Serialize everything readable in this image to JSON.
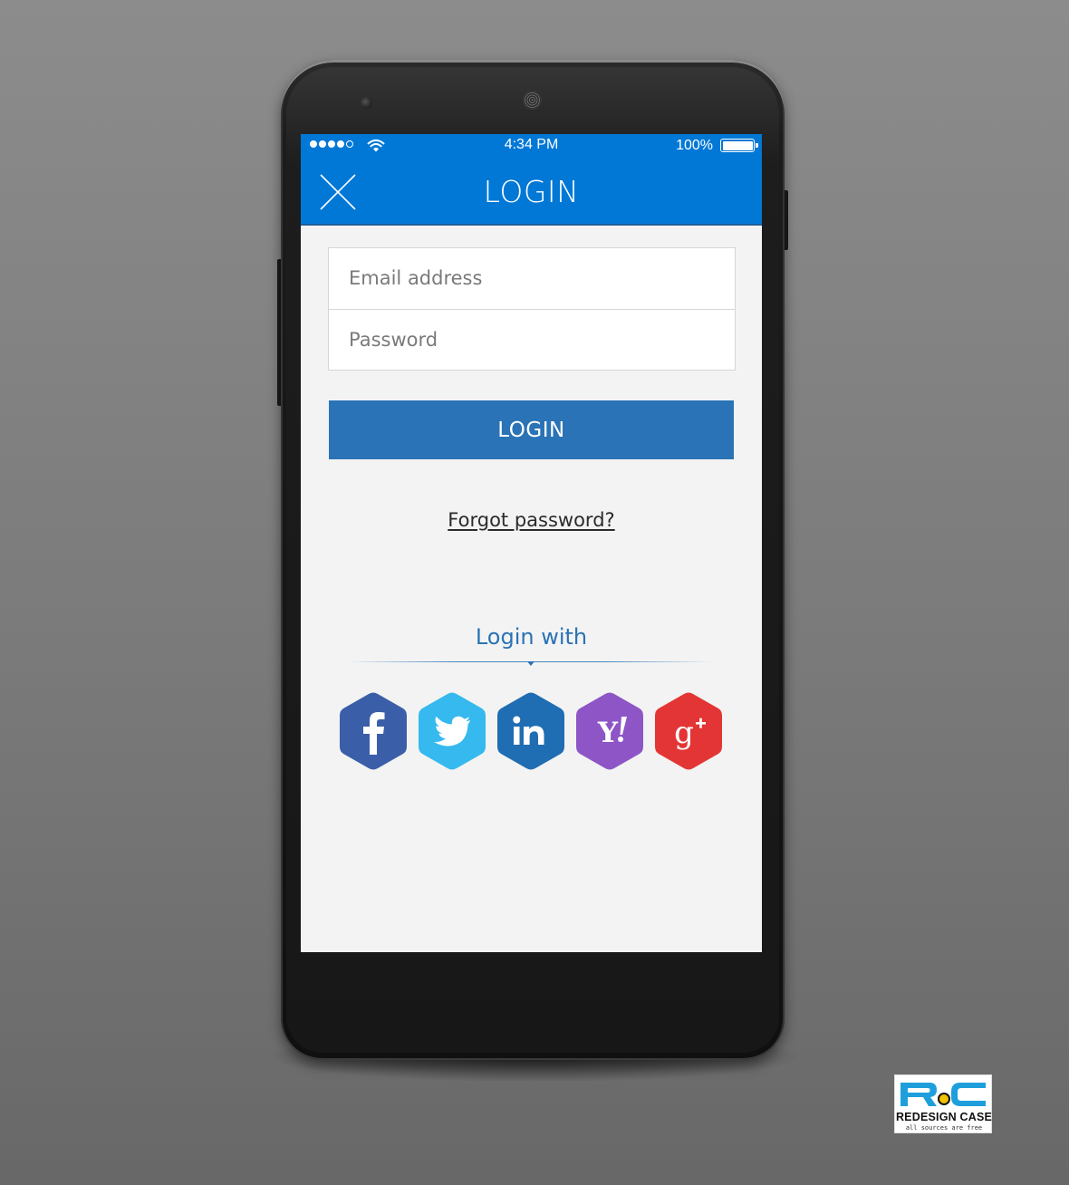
{
  "colors": {
    "appbar": "#0278d6",
    "primary_button": "#2a73b6",
    "screen_background": "#f3f3f3",
    "facebook": "#3b5ea9",
    "twitter": "#35b9ee",
    "linkedin": "#1f6db2",
    "yahoo": "#8d55c6",
    "google_plus": "#e33535"
  },
  "status_bar": {
    "signal_dots_filled": 4,
    "signal_dots_total": 5,
    "time": "4:34 PM",
    "battery_percent": "100%",
    "battery_level": 1.0,
    "wifi_icon": "wifi-icon"
  },
  "header": {
    "close_icon": "close-icon",
    "title": "LOGIN"
  },
  "form": {
    "email_placeholder": "Email address",
    "email_value": "",
    "password_placeholder": "Password",
    "password_value": "",
    "submit_label": "LOGIN"
  },
  "links": {
    "forgot_password": "Forgot password?"
  },
  "social": {
    "heading": "Login with",
    "providers": [
      {
        "name": "facebook",
        "glyph": "f",
        "icon": "facebook-icon"
      },
      {
        "name": "twitter",
        "glyph": "",
        "icon": "twitter-icon"
      },
      {
        "name": "linkedin",
        "glyph": "in",
        "icon": "linkedin-icon"
      },
      {
        "name": "yahoo",
        "glyph": "Y!",
        "icon": "yahoo-icon"
      },
      {
        "name": "google_plus",
        "glyph": "g+",
        "icon": "google-plus-icon"
      }
    ]
  },
  "watermark": {
    "name": "REDESIGN CASE",
    "tagline": "all sources are free"
  }
}
